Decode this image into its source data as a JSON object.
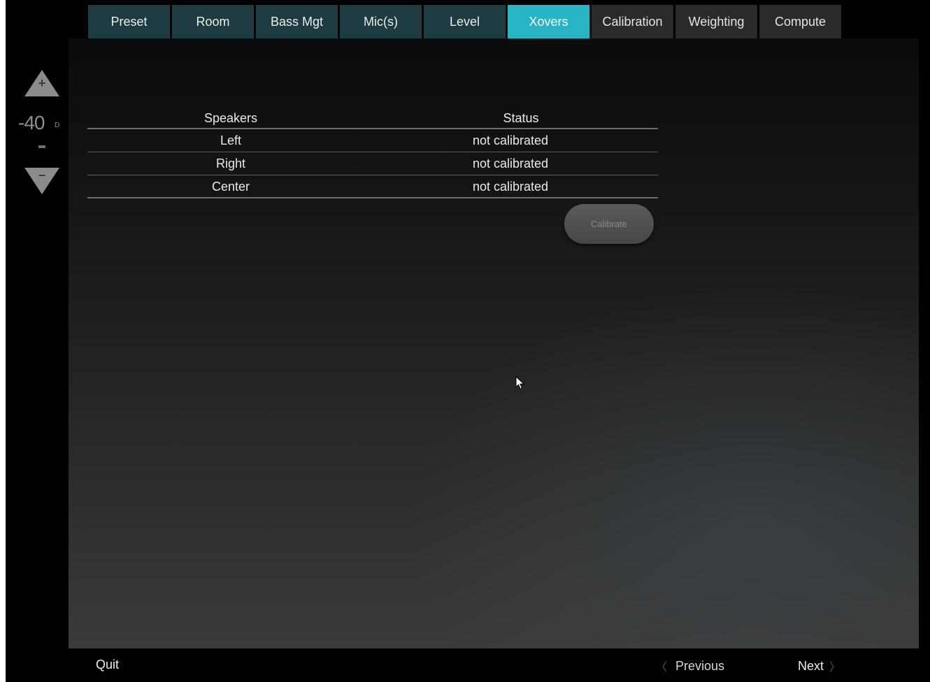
{
  "tabs": [
    {
      "label": "Preset",
      "state": "done"
    },
    {
      "label": "Room",
      "state": "done"
    },
    {
      "label": "Bass Mgt",
      "state": "done"
    },
    {
      "label": "Mic(s)",
      "state": "done"
    },
    {
      "label": "Level",
      "state": "done"
    },
    {
      "label": "Xovers",
      "state": "active"
    },
    {
      "label": "Calibration",
      "state": "pending"
    },
    {
      "label": "Weighting",
      "state": "pending"
    },
    {
      "label": "Compute",
      "state": "pending"
    }
  ],
  "volume": {
    "value": "-40",
    "unit": "D",
    "up_icon": "triangle-up-plus-icon",
    "down_icon": "triangle-down-minus-icon",
    "up_sign": "+",
    "down_sign": "−"
  },
  "table": {
    "headers": {
      "speakers": "Speakers",
      "status": "Status"
    },
    "rows": [
      {
        "speaker": "Left",
        "status": "not calibrated"
      },
      {
        "speaker": "Right",
        "status": "not calibrated"
      },
      {
        "speaker": "Center",
        "status": "not calibrated"
      }
    ]
  },
  "calibrate_label": "Calibrate",
  "footer": {
    "quit": "Quit",
    "previous": "Previous",
    "next": "Next",
    "prev_chevron": "〈",
    "next_chevron": "〉"
  },
  "colors": {
    "active_tab": "#27b5c6",
    "done_tab": "#1d3b41",
    "pending_tab": "#2a2a2a"
  }
}
